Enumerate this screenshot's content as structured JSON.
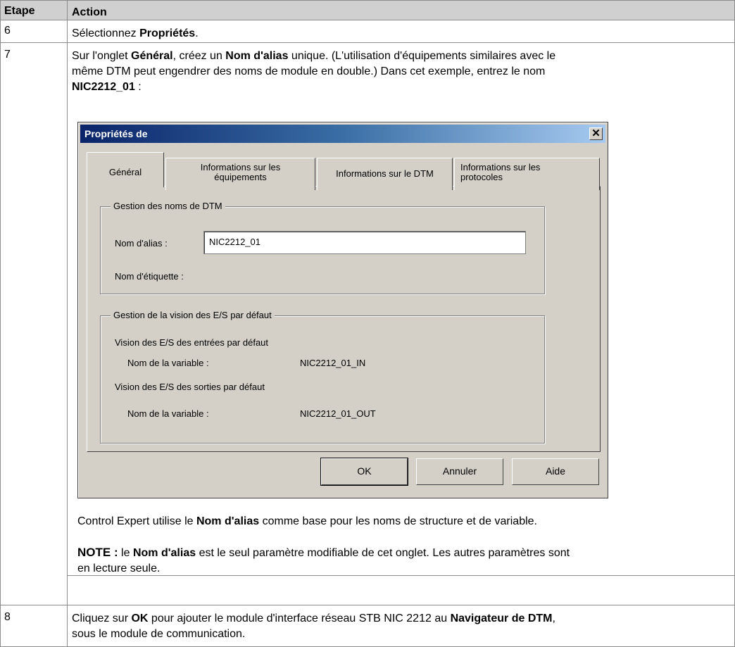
{
  "table": {
    "headers": {
      "step": "Etape",
      "action": "Action"
    },
    "row6": {
      "step": "6",
      "text_prefix": "Sélectionnez ",
      "bold": "Propriétés",
      "text_suffix": "."
    },
    "row7": {
      "step": "7",
      "line1_a": "Sur l'onglet ",
      "line1_bold1": "Général",
      "line1_b": ", créez un ",
      "line1_bold2": "Nom d'alias",
      "line1_c": " unique. (L'utilisation d'équipements similaires avec le",
      "line2": "même DTM peut engendrer des noms de module en double.) Dans cet exemple, entrez le nom",
      "line3_bold": "NIC2212_01",
      "line3_suffix": " :",
      "after_a": "Control Expert utilise le ",
      "after_bold": "Nom d'alias",
      "after_b": " comme base pour les noms de structure et de variable.",
      "note_label": "NOTE :",
      "note_a": " le ",
      "note_bold": "Nom d'alias",
      "note_b": " est le seul paramètre modifiable de cet onglet. Les autres paramètres sont",
      "note_line2": "en lecture seule."
    },
    "row8": {
      "step": "8",
      "a": "Cliquez sur ",
      "bold1": "OK",
      "b": " pour ajouter le module d'interface réseau STB NIC 2212 au ",
      "bold2": "Navigateur de DTM",
      "c": ",",
      "line2": "sous le module de communication."
    }
  },
  "dialog": {
    "title": "Propriétés de",
    "close_glyph": "✕",
    "tabs": [
      {
        "l1": "Général",
        "l2": ""
      },
      {
        "l1": "Informations sur les",
        "l2": "équipements"
      },
      {
        "l1": "Informations sur le DTM",
        "l2": ""
      },
      {
        "l1": "Informations sur les",
        "l2": "protocoles"
      }
    ],
    "group1": {
      "legend": "Gestion des noms de DTM",
      "alias_label": "Nom d'alias :",
      "alias_value": "NIC2212_01",
      "tag_label": "Nom d'étiquette :"
    },
    "group2": {
      "legend": "Gestion de la vision des E/S par défaut",
      "inputs_heading": "Vision des E/S des entrées par défaut",
      "var_label_in": "Nom de la variable :",
      "var_value_in": "NIC2212_01_IN",
      "outputs_heading": "Vision des E/S des sorties par défaut",
      "var_label_out": "Nom de la variable :",
      "var_value_out": "NIC2212_01_OUT"
    },
    "buttons": {
      "ok": "OK",
      "cancel": "Annuler",
      "help": "Aide"
    }
  }
}
